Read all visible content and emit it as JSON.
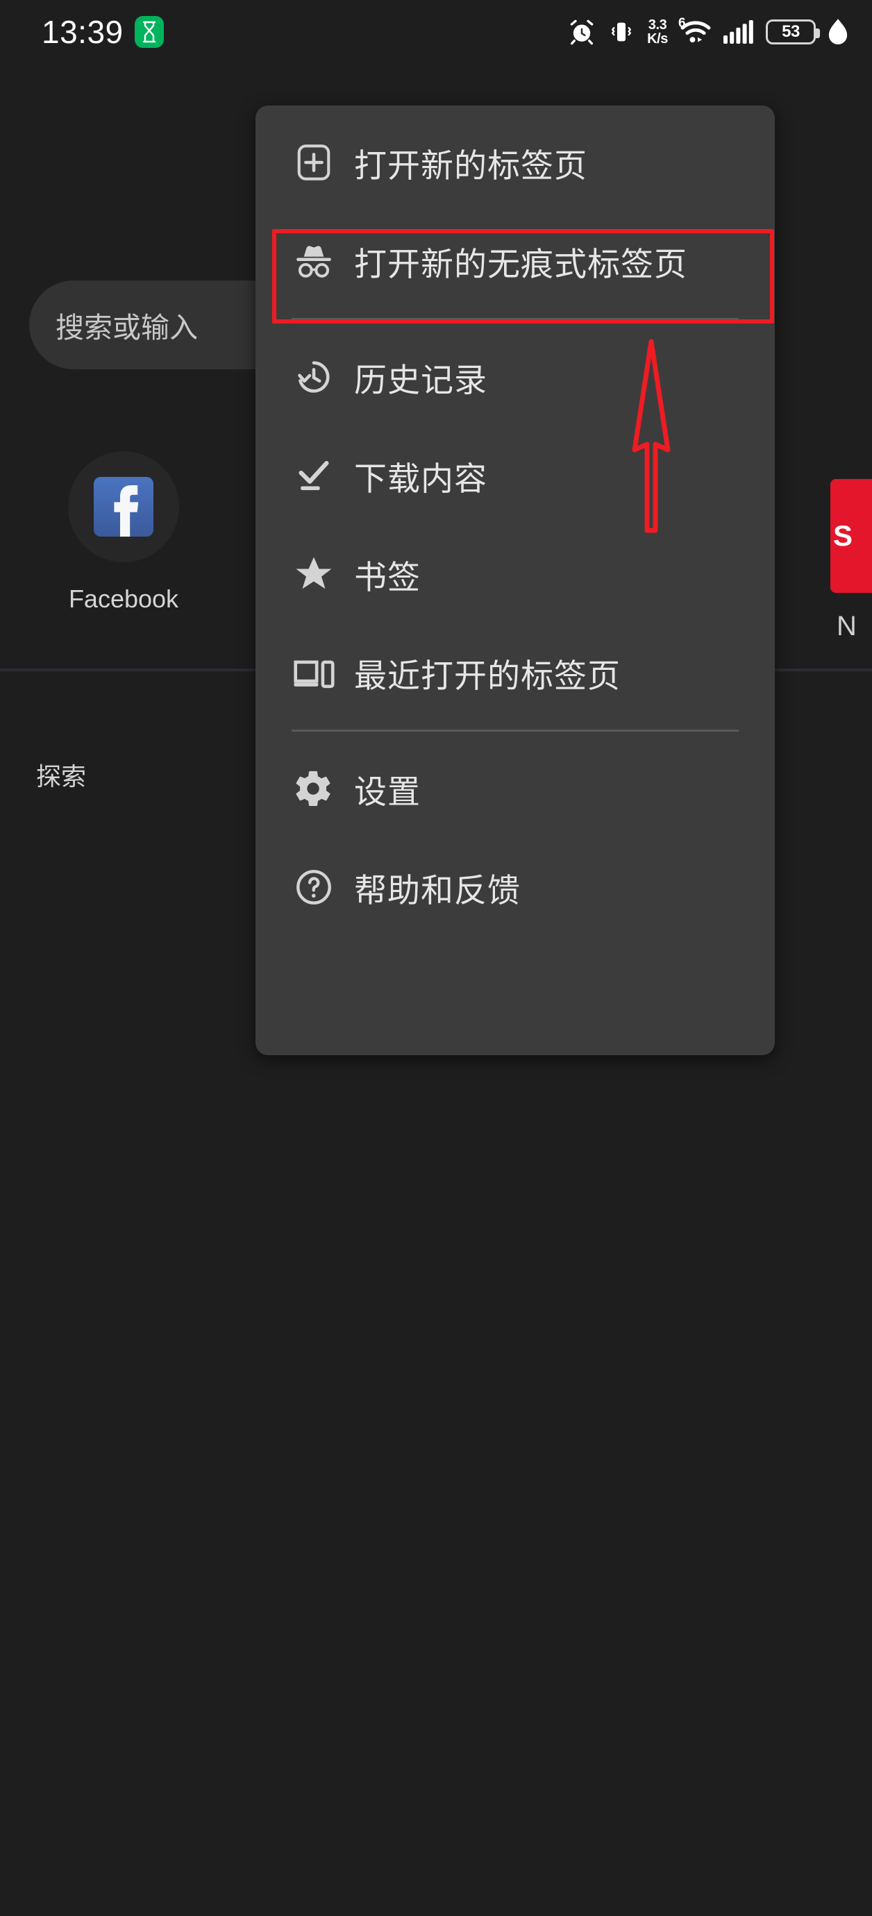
{
  "status_bar": {
    "clock": "13:39",
    "hourglass_icon": "hourglass-icon",
    "alarm_icon": "alarm-clock-icon",
    "vibrate_icon": "vibrate-icon",
    "network_speed": "3.3\nK/s",
    "network_speed_value": "3.3",
    "network_speed_unit": "K/s",
    "wifi_generation": "6",
    "wifi_icon": "wifi-icon",
    "signal_icon": "cellular-signal-icon",
    "battery_level": "53",
    "battery_icon": "battery-icon",
    "leaf_icon": "leaf-icon"
  },
  "home": {
    "omnibox_placeholder": "搜索或输入",
    "explore_label": "探索",
    "tiles": [
      {
        "label": "Facebook",
        "icon": "facebook-icon",
        "glyph": "f",
        "color": "#3b5a9b"
      },
      {
        "label": "N",
        "icon": "news-site-icon",
        "glyph": "S",
        "color": "#e3162b"
      }
    ]
  },
  "menu": {
    "items": [
      {
        "label": "打开新的标签页",
        "icon": "new-tab-icon"
      },
      {
        "label": "打开新的无痕式标签页",
        "icon": "incognito-icon",
        "highlighted": true
      },
      {
        "label": "历史记录",
        "icon": "history-icon"
      },
      {
        "label": "下载内容",
        "icon": "download-icon"
      },
      {
        "label": "书签",
        "icon": "star-icon"
      },
      {
        "label": "最近打开的标签页",
        "icon": "recent-tabs-icon"
      },
      {
        "label": "设置",
        "icon": "gear-icon"
      },
      {
        "label": "帮助和反馈",
        "icon": "help-circle-icon"
      }
    ]
  },
  "annotations": {
    "highlight_color": "#ee1c23",
    "highlight_target": "打开新的无痕式标签页",
    "arrow_icon": "up-arrow-annotation"
  }
}
